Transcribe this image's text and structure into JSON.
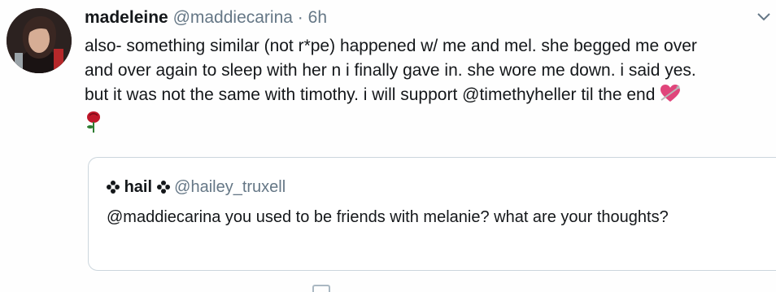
{
  "tweet": {
    "author_name": "madeleine",
    "author_handle": "@maddiecarina",
    "separator": "·",
    "time": "6h",
    "text_line1": "also- something similar (not r*pe) happened w/ me and mel. she begged me over",
    "text_line2": "and over again to sleep with her n i finally gave in. she wore me down. i said yes.",
    "text_line3": "but it was not the same with timothy. i will support @timethyheller til the end",
    "emoji_heart": "heart-with-arrow-emoji",
    "emoji_rose": "rose-emoji"
  },
  "quote": {
    "author_name": "hail",
    "author_handle": "@hailey_truxell",
    "flower_icon": "flower-icon",
    "text": "@maddiecarina you used to be friends with melanie? what are your thoughts?"
  },
  "colors": {
    "primary_text": "#14171a",
    "secondary_text": "#657786",
    "border": "#ccd6dd",
    "heart": "#e0457b",
    "rose": "#c0182a"
  }
}
